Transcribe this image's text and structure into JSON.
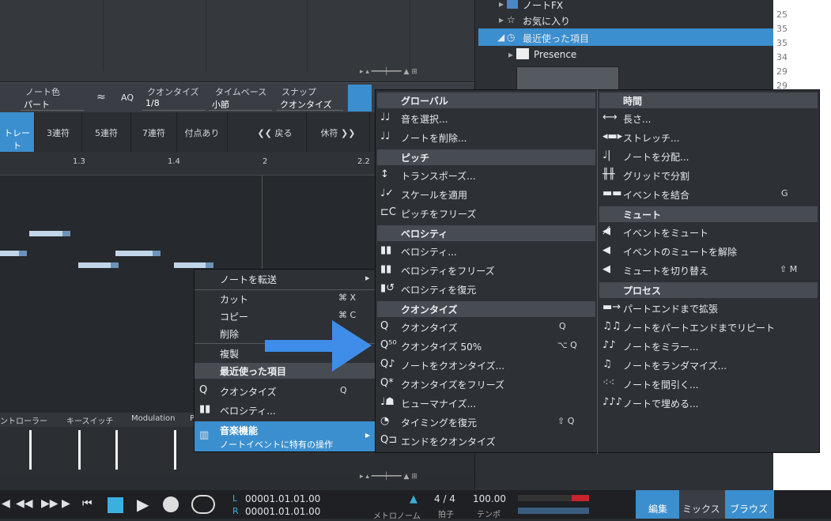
{
  "browser": {
    "items": [
      "ノートFX",
      "お気に入り",
      "最近使った項目",
      "Presence"
    ]
  },
  "rightnums": [
    "25",
    "35",
    "35",
    "34",
    "29",
    "29"
  ],
  "editor": {
    "note_color_label": "ノート色",
    "note_color_value": "パート",
    "quantize_label": "クオンタイズ",
    "quantize_value": "1/8",
    "timebase_label": "タイムベース",
    "timebase_value": "小節",
    "snap_label": "スナップ",
    "snap_value": "クオンタイズ",
    "aq": "AQ"
  },
  "tuplets": [
    "トレート",
    "3連符",
    "5連符",
    "7連符",
    "付点あり",
    "戻る",
    "休符"
  ],
  "ruler": [
    "1.3",
    "1.4",
    "2",
    "2.2"
  ],
  "ctrl": [
    "ントローラー",
    "キースイッチ",
    "Modulation",
    "P"
  ],
  "context": {
    "send": "ノートを転送",
    "cut": "カット",
    "cut_sc": "⌘ X",
    "copy": "コピー",
    "copy_sc": "⌘ C",
    "delete": "削除",
    "delete_sc": "D",
    "dup": "複製",
    "dup_sc": "D",
    "recent": "最近使った項目",
    "quantize": "クオンタイズ",
    "quantize_sc": "Q",
    "velocity": "ベロシティ...",
    "music": "音楽機能",
    "music_sub": "ノートイベントに特有の操作"
  },
  "sub_left": {
    "global": "グローバル",
    "sel": "音を選択...",
    "del": "ノートを削除...",
    "pitch": "ピッチ",
    "transpose": "トランスポーズ...",
    "scale": "スケールを適用",
    "freeze_pitch": "ピッチをフリーズ",
    "velocity": "ベロシティ",
    "vel": "ベロシティ...",
    "freeze_vel": "ベロシティをフリーズ",
    "restore_vel": "ベロシティを復元",
    "quantize": "クオンタイズ",
    "q": "クオンタイズ",
    "q_sc": "Q",
    "q50": "クオンタイズ 50%",
    "q50_sc": "⌥ Q",
    "qnotes": "ノートをクオンタイズ...",
    "qfreeze": "クオンタイズをフリーズ",
    "humanize": "ヒューマナイズ...",
    "timing": "タイミングを復元",
    "timing_sc": "⇧ Q",
    "qend": "エンドをクオンタイズ"
  },
  "sub_right": {
    "time": "時間",
    "length": "長さ...",
    "stretch": "ストレッチ...",
    "split": "ノートを分配...",
    "grid": "グリッドで分割",
    "merge": "イベントを結合",
    "merge_sc": "G",
    "mute": "ミュート",
    "mute_ev": "イベントをミュート",
    "unmute": "イベントのミュートを解除",
    "toggle": "ミュートを切り替え",
    "toggle_sc": "⇧ M",
    "process": "プロセス",
    "extend": "パートエンドまで拡張",
    "repeat": "ノートをパートエンドまでリピート",
    "mirror": "ノートをミラー...",
    "random": "ノートをランダマイズ...",
    "thin": "ノートを間引く...",
    "fill": "ノートで埋める..."
  },
  "transport": {
    "L": "L",
    "R": "R",
    "l_time": "00001.01.01.00",
    "r_time": "00001.01.01.00",
    "metronome": "メトロノーム",
    "sig": "4 / 4",
    "sig_lbl": "拍子",
    "tempo": "100.00",
    "tempo_lbl": "テンポ",
    "edit": "編集",
    "mix": "ミックス",
    "browse": "ブラウズ"
  },
  "colors": {
    "accent": "#3b8fce",
    "arrow": "#3f8de8"
  }
}
